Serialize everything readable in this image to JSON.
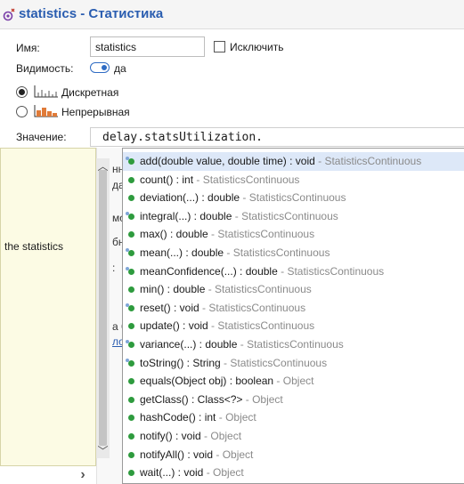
{
  "header": {
    "title": "statistics - Статистика",
    "icon": "statistics-object-icon"
  },
  "form": {
    "name_label": "Имя:",
    "name_value": "statistics",
    "exclude_label": "Исключить",
    "exclude_checked": false,
    "visibility_label": "Видимость:",
    "visibility_value": "да",
    "kind_options": [
      {
        "label": "Дискретная",
        "icon": "discrete-histogram-icon",
        "selected": true
      },
      {
        "label": "Непрерывная",
        "icon": "continuous-histogram-icon",
        "selected": false
      }
    ],
    "value_label": "Значение:",
    "value_text": "delay.statsUtilization."
  },
  "tooltip": {
    "text": "the statistics"
  },
  "background_fragments": [
    "нн",
    "да",
    "мо",
    "бн",
    ":",
    "а 6",
    "ло"
  ],
  "completion": {
    "selected_index": 0,
    "items": [
      {
        "signature": "add(double value, double time) : void",
        "owner": "StatisticsContinuous",
        "icon": "method-icon-static"
      },
      {
        "signature": "count() : int",
        "owner": "StatisticsContinuous",
        "icon": "method-icon"
      },
      {
        "signature": "deviation(...) : double",
        "owner": "StatisticsContinuous",
        "icon": "method-icon"
      },
      {
        "signature": "integral(...) : double",
        "owner": "StatisticsContinuous",
        "icon": "method-icon-static"
      },
      {
        "signature": "max() : double",
        "owner": "StatisticsContinuous",
        "icon": "method-icon"
      },
      {
        "signature": "mean(...) : double",
        "owner": "StatisticsContinuous",
        "icon": "method-icon-static"
      },
      {
        "signature": "meanConfidence(...) : double",
        "owner": "StatisticsContinuous",
        "icon": "method-icon-static"
      },
      {
        "signature": "min() : double",
        "owner": "StatisticsContinuous",
        "icon": "method-icon"
      },
      {
        "signature": "reset() : void",
        "owner": "StatisticsContinuous",
        "icon": "method-icon-static"
      },
      {
        "signature": "update() : void",
        "owner": "StatisticsContinuous",
        "icon": "method-icon"
      },
      {
        "signature": "variance(...) : double",
        "owner": "StatisticsContinuous",
        "icon": "method-icon-static"
      },
      {
        "signature": "toString() : String",
        "owner": "StatisticsContinuous",
        "icon": "method-icon-static"
      },
      {
        "signature": "equals(Object obj) : boolean",
        "owner": "Object",
        "icon": "method-icon"
      },
      {
        "signature": "getClass() : Class<?>",
        "owner": "Object",
        "icon": "method-icon"
      },
      {
        "signature": "hashCode() : int",
        "owner": "Object",
        "icon": "method-icon"
      },
      {
        "signature": "notify() : void",
        "owner": "Object",
        "icon": "method-icon"
      },
      {
        "signature": "notifyAll() : void",
        "owner": "Object",
        "icon": "method-icon"
      },
      {
        "signature": "wait(...) : void",
        "owner": "Object",
        "icon": "method-icon"
      }
    ]
  },
  "colors": {
    "title": "#2a5db0",
    "method_icon": "#2e9b3e",
    "selection": "#dde8f8",
    "tooltip_bg": "#fcfbe4"
  }
}
